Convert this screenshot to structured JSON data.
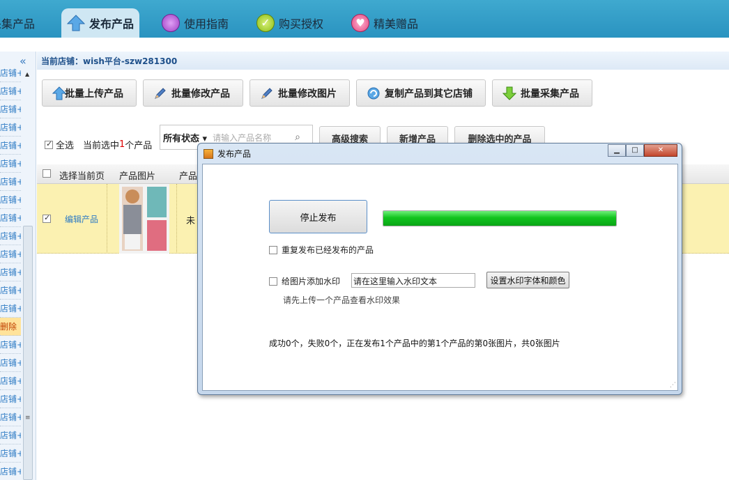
{
  "nav": {
    "items": [
      {
        "label": "采集产品"
      },
      {
        "label": "发布产品"
      },
      {
        "label": "使用指南"
      },
      {
        "label": "购买授权"
      },
      {
        "label": "精美赠品"
      }
    ]
  },
  "left_panel": {
    "collapse_glyph": "«",
    "item_label": "店铺+",
    "delete_label": "删除"
  },
  "store": {
    "label": "当前店铺：wish平台-szw281300"
  },
  "toolbar": {
    "batch_upload": "批量上传产品",
    "batch_edit": "批量修改产品",
    "batch_edit_images": "批量修改图片",
    "copy_to_store": "复制产品到其它店铺",
    "batch_collect": "批量采集产品"
  },
  "filter": {
    "select_all": "全选",
    "selected_prefix": "当前选中",
    "selected_count": "1",
    "selected_suffix": "个产品",
    "status_select": "所有状态 ▾",
    "name_placeholder": "请输入产品名称",
    "advanced_search": "高级搜索",
    "add_product": "新增产品",
    "delete_selected": "删除选中的产品"
  },
  "table": {
    "headers": [
      "选择当前页",
      "产品图片",
      "产品"
    ],
    "row": {
      "edit_link": "编辑产品",
      "status": "未"
    }
  },
  "dialog": {
    "title": "发布产品",
    "stop_button": "停止发布",
    "progress": 1.0,
    "repeat_publish": "重复发布已经发布的产品",
    "add_watermark": "给图片添加水印",
    "watermark_text": "请在这里输入水印文本",
    "watermark_font_button": "设置水印字体和颜色",
    "hint": "请先上传一个产品查看水印效果",
    "status_text": "成功0个，失败0个，正在发布1个产品中的第1个产品的第0张图片，共0张图片"
  },
  "colors": {
    "nav_bg": "#2a93c0",
    "progress_green": "#11c41e",
    "row_highlight": "#fbf1b1",
    "link_blue": "#2e7bc4"
  }
}
